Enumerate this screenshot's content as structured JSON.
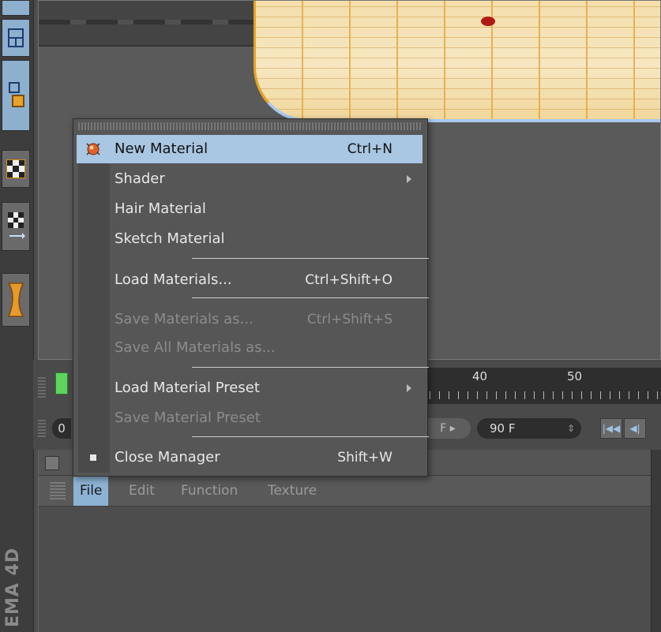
{
  "app": {
    "brand": "EMA 4D"
  },
  "timeline": {
    "ruler_labels": [
      "40",
      "50"
    ],
    "start_field": "0",
    "frame_button": "F",
    "end_field": "90 F",
    "transport": [
      "first-frame",
      "prev-key"
    ]
  },
  "material_manager": {
    "menubar": [
      {
        "label": "File",
        "active": true
      },
      {
        "label": "Edit",
        "active": false
      },
      {
        "label": "Function",
        "active": false
      },
      {
        "label": "Texture",
        "active": false
      }
    ]
  },
  "file_menu": {
    "items": [
      {
        "label": "New Material",
        "shortcut": "Ctrl+N",
        "highlighted": true,
        "enabled": true,
        "icon": "material-sphere-icon"
      },
      {
        "label": "Shader",
        "shortcut": "",
        "submenu": true,
        "enabled": true
      },
      {
        "label": "Hair Material",
        "shortcut": "",
        "enabled": true
      },
      {
        "label": "Sketch Material",
        "shortcut": "",
        "enabled": true
      },
      {
        "label": "Load Materials...",
        "shortcut": "Ctrl+Shift+O",
        "enabled": true
      },
      {
        "label": "Save Materials as...",
        "shortcut": "Ctrl+Shift+S",
        "enabled": false
      },
      {
        "label": "Save All Materials as...",
        "shortcut": "",
        "enabled": false
      },
      {
        "label": "Load Material Preset",
        "shortcut": "",
        "submenu": true,
        "enabled": true
      },
      {
        "label": "Save Material Preset",
        "shortcut": "",
        "enabled": false
      },
      {
        "label": "Close Manager",
        "shortcut": "Shift+W",
        "enabled": true,
        "icon": "small-square-icon"
      }
    ]
  },
  "colors": {
    "menu_highlight": "#a9c6e2",
    "menubar_active": "#8db3d4",
    "frame_marker": "#5fd35f",
    "model_surface": "#f3dca6"
  }
}
